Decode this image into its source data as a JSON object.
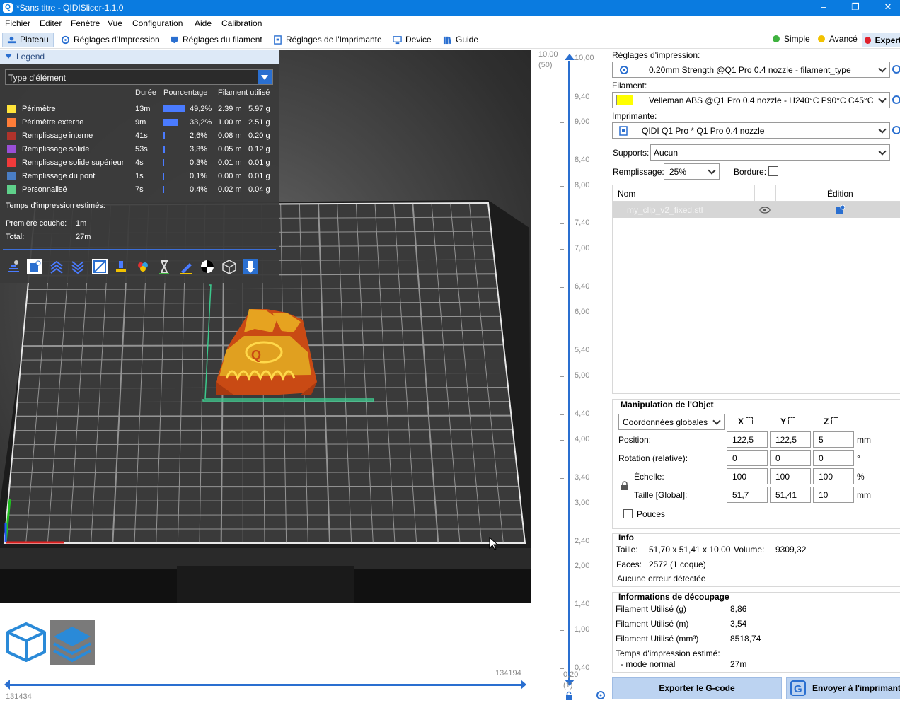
{
  "window": {
    "title": "*Sans titre - QIDISlicer-1.1.0",
    "min": "–",
    "max": "❐",
    "close": "✕"
  },
  "menu": [
    "Fichier",
    "Editer",
    "Fenêtre",
    "Vue",
    "Configuration",
    "Aide",
    "Calibration"
  ],
  "tabs": [
    "Plateau",
    "Réglages d'Impression",
    "Réglages du filament",
    "Réglages de l'Imprimante",
    "Device",
    "Guide"
  ],
  "modes": [
    {
      "label": "Simple",
      "color": "#3fb23f"
    },
    {
      "label": "Avancé",
      "color": "#f2c200"
    },
    {
      "label": "Expert",
      "color": "#e0202c"
    }
  ],
  "legend": {
    "title": "Legend",
    "select": "Type d'élément",
    "columns": [
      "Durée",
      "Pourcentage",
      "Filament utilisé"
    ],
    "rows": [
      {
        "name": "Périmètre",
        "color": "#ffe43a",
        "duration": "13m",
        "percent": "49,2%",
        "pct": 49.2,
        "m": "2.39 m",
        "g": "5.97 g"
      },
      {
        "name": "Périmètre externe",
        "color": "#ff7d38",
        "duration": "9m",
        "percent": "33,2%",
        "pct": 33.2,
        "m": "1.00 m",
        "g": "2.51 g"
      },
      {
        "name": "Remplissage interne",
        "color": "#b0332b",
        "duration": "41s",
        "percent": "2,6%",
        "pct": 2.6,
        "m": "0.08 m",
        "g": "0.20 g"
      },
      {
        "name": "Remplissage solide",
        "color": "#9a4fd6",
        "duration": "53s",
        "percent": "3,3%",
        "pct": 3.3,
        "m": "0.05 m",
        "g": "0.12 g"
      },
      {
        "name": "Remplissage solide supérieur",
        "color": "#f03a3a",
        "duration": "4s",
        "percent": "0,3%",
        "pct": 0.3,
        "m": "0.01 m",
        "g": "0.01 g"
      },
      {
        "name": "Remplissage du pont",
        "color": "#4a7ec4",
        "duration": "1s",
        "percent": "0,1%",
        "pct": 0.1,
        "m": "0.00 m",
        "g": "0.01 g"
      },
      {
        "name": "Personnalisé",
        "color": "#5fd08a",
        "duration": "7s",
        "percent": "0,4%",
        "pct": 0.4,
        "m": "0.02 m",
        "g": "0.04 g"
      }
    ],
    "est_label": "Temps d'impression estimés:",
    "first_layer_label": "Première couche:",
    "first_layer": "1m",
    "total_label": "Total:",
    "total": "27m"
  },
  "view": {
    "bottom_left_num": "131434",
    "bottom_right_num": "134194"
  },
  "ruler": {
    "top": "10,00",
    "top_count": "(50)",
    "labels": [
      "10,00",
      "9,40",
      "9,00",
      "8,40",
      "8,00",
      "7,40",
      "7,00",
      "6,40",
      "6,00",
      "5,40",
      "5,00",
      "4,40",
      "4,00",
      "3,40",
      "3,00",
      "2,40",
      "2,00",
      "1,40",
      "1,00",
      "0,40"
    ],
    "bottom": "0,20",
    "bottom_count": "(1)"
  },
  "settings": {
    "print_label": "Réglages d'impression:",
    "print_value": "0.20mm Strength @Q1 Pro 0.4 nozzle - filament_type",
    "filament_label": "Filament:",
    "filament_value": "Velleman ABS @Q1 Pro 0.4 nozzle - H240°C P90°C C45°C",
    "filament_color": "#ffff00",
    "printer_label": "Imprimante:",
    "printer_value": "QIDI Q1 Pro * Q1 Pro 0.4 nozzle",
    "supports_label": "Supports:",
    "supports_value": "Aucun",
    "infill_label": "Remplissage:",
    "infill_value": "25%",
    "brim_label": "Bordure:"
  },
  "objects": {
    "col_name": "Nom",
    "col_edit": "Édition",
    "item": "my_clip_v2_fixed.stl"
  },
  "manip": {
    "title": "Manipulation de l'Objet",
    "coord": "Coordonnées globales",
    "axes": [
      "X",
      "Y",
      "Z"
    ],
    "rows": [
      {
        "label": "Position:",
        "x": "122,5",
        "y": "122,5",
        "z": "5",
        "unit": "mm"
      },
      {
        "label": "Rotation (relative):",
        "x": "0",
        "y": "0",
        "z": "0",
        "unit": "°"
      },
      {
        "label": "Échelle:",
        "x": "100",
        "y": "100",
        "z": "100",
        "unit": "%"
      },
      {
        "label": "Taille [Global]:",
        "x": "51,7",
        "y": "51,41",
        "z": "10",
        "unit": "mm"
      }
    ],
    "inches": "Pouces"
  },
  "info": {
    "title": "Info",
    "size_label": "Taille:",
    "size": "51,70 x 51,41 x 10,00",
    "volume_label": "Volume:",
    "volume": "9309,32",
    "faces_label": "Faces:",
    "faces": "2572 (1 coque)",
    "errors": "Aucune erreur détectée"
  },
  "slice": {
    "title": "Informations de découpage",
    "rows": [
      {
        "label": "Filament Utilisé (g)",
        "value": "8,86"
      },
      {
        "label": "Filament Utilisé (m)",
        "value": "3,54"
      },
      {
        "label": "Filament Utilisé (mm³)",
        "value": "8518,74"
      }
    ],
    "time_label": "Temps d'impression estimé:",
    "mode_label": "- mode normal",
    "mode_value": "27m"
  },
  "buttons": {
    "export": "Exporter le G-code",
    "send": "Envoyer à l'imprimante"
  }
}
